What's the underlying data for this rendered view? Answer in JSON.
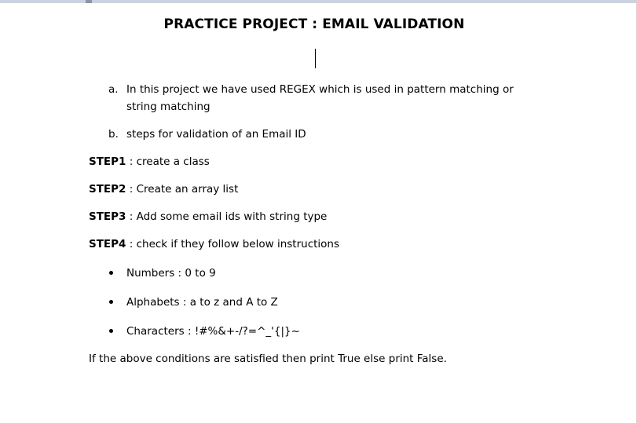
{
  "document": {
    "title": "PRACTICE PROJECT : EMAIL VALIDATION",
    "ordered_items": [
      {
        "marker": "a.",
        "text": "In this project we have used REGEX which is used in pattern matching or string matching"
      },
      {
        "marker": "b.",
        "text": "steps for validation of an Email ID"
      }
    ],
    "steps": [
      {
        "label": "STEP1",
        "text": " : create a class"
      },
      {
        "label": "STEP2",
        "text": " : Create an array list"
      },
      {
        "label": "STEP3",
        "text": " : Add some email ids with string type"
      },
      {
        "label": "STEP4",
        "text": " : check if they follow below instructions"
      }
    ],
    "bullets": [
      {
        "text": "Numbers : 0 to 9"
      },
      {
        "text": "Alphabets : a to z and A to Z"
      },
      {
        "text": "Characters : !#%&+-/?=^_'{|}~"
      }
    ],
    "conclusion": "If the above conditions are satisfied then print True else print False."
  }
}
